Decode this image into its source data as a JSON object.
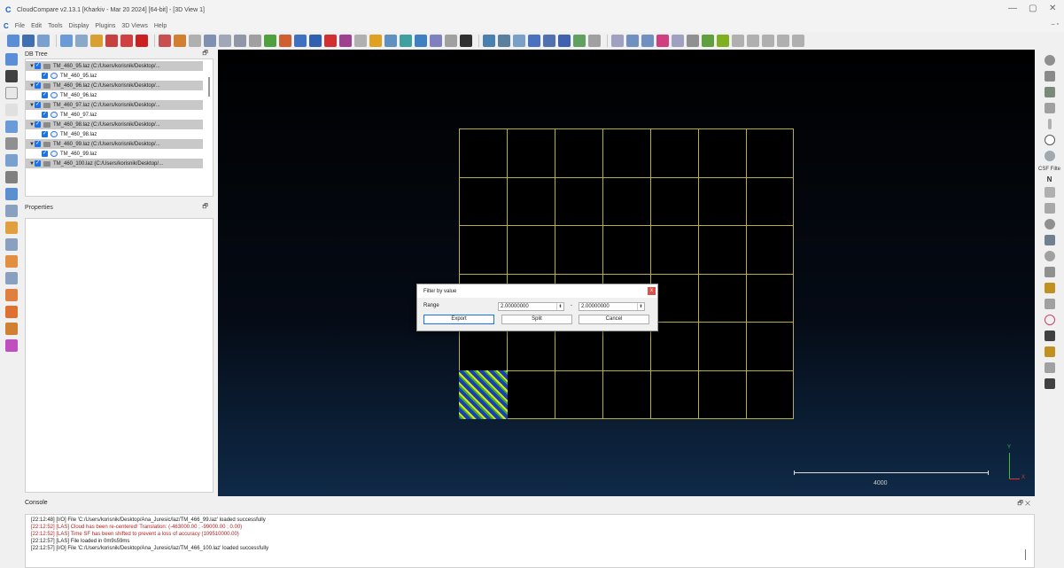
{
  "window": {
    "title": "CloudCompare v2.13.1 [Kharkiv - Mar 20 2024] [64-bit] - [3D View 1]",
    "minimize": "—",
    "restore": "▢",
    "close": "✕"
  },
  "menubar": {
    "items": [
      "File",
      "Edit",
      "Tools",
      "Display",
      "Plugins",
      "3D Views",
      "Help"
    ],
    "mdi_controls": "– ▫"
  },
  "db_tree": {
    "header": "DB Tree",
    "items": [
      {
        "label": "TM_460_95.laz (C:/Users/korisnik/Desktop/...",
        "type": "folder"
      },
      {
        "label": "TM_460_95.laz",
        "type": "cloud"
      },
      {
        "label": "TM_460_96.laz (C:/Users/korisnik/Desktop/...",
        "type": "folder"
      },
      {
        "label": "TM_460_96.laz",
        "type": "cloud"
      },
      {
        "label": "TM_460_97.laz (C:/Users/korisnik/Desktop/...",
        "type": "folder"
      },
      {
        "label": "TM_460_97.laz",
        "type": "cloud"
      },
      {
        "label": "TM_460_98.laz (C:/Users/korisnik/Desktop/...",
        "type": "folder"
      },
      {
        "label": "TM_460_98.laz",
        "type": "cloud"
      },
      {
        "label": "TM_460_99.laz (C:/Users/korisnik/Desktop/...",
        "type": "folder"
      },
      {
        "label": "TM_460_99.laz",
        "type": "cloud"
      },
      {
        "label": "TM_460_100.laz (C:/Users/korisnik/Desktop/...",
        "type": "folder"
      }
    ]
  },
  "properties": {
    "header": "Properties"
  },
  "view3d": {
    "scale_label": "4000",
    "axis_y": "Y",
    "axis_x": "X"
  },
  "dialog": {
    "title": "Filter by value",
    "close": "x",
    "range_label": "Range",
    "range_min": "2.00000000",
    "range_max": "2.00000000",
    "separator": "-",
    "spin_arrows": "⬍",
    "export": "Export",
    "split": "Split",
    "cancel": "Cancel"
  },
  "right_toolbar": {
    "csf_label": "CSF Filte",
    "n_label": "N"
  },
  "console": {
    "header": "Console",
    "controls": "🗗 ✕",
    "lines": [
      {
        "text": "[22:12:48] [I/O] File 'C:/Users/korisnik/Desktop/Ana_Juresic/laz/TM_466_99.laz' loaded successfully",
        "color": "#222222"
      },
      {
        "text": "[22:12:52] [LAS] Cloud has been re-centered! Translation: (-463000.00 ; -99000.00 ; 0.00)",
        "color": "#b22222"
      },
      {
        "text": "[22:12:52] [LAS] Time SF has been shifted to prevent a loss of accuracy (109510000.00)",
        "color": "#b22222"
      },
      {
        "text": "[22:12:57] [LAS] File loaded in 0m9s59ms",
        "color": "#222222"
      },
      {
        "text": "[22:12:57] [I/O] File 'C:/Users/korisnik/Desktop/Ana_Juresic/laz/TM_466_100.laz' loaded successfully",
        "color": "#222222"
      }
    ]
  },
  "colors": {
    "accent": "#1a73e8",
    "grid": "#b7ae4a",
    "close_red": "#d9534f"
  }
}
